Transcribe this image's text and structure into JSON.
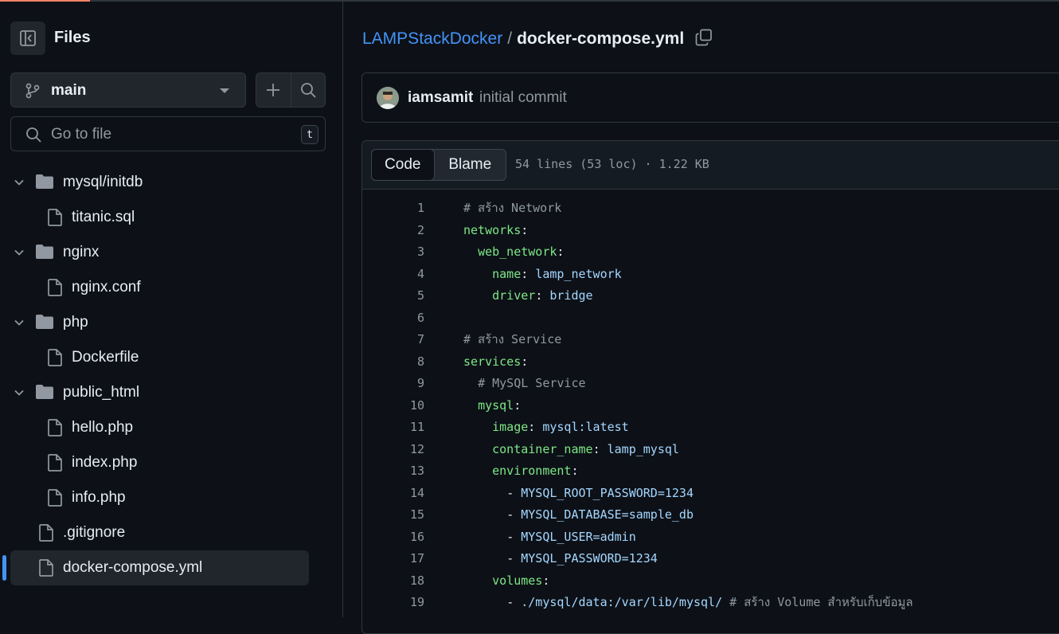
{
  "sidebar": {
    "title": "Files",
    "branch": "main",
    "search_placeholder": "Go to file",
    "search_shortcut": "t",
    "tree": [
      {
        "label": "mysql/initdb",
        "type": "folder"
      },
      {
        "label": "titanic.sql",
        "type": "file"
      },
      {
        "label": "nginx",
        "type": "folder"
      },
      {
        "label": "nginx.conf",
        "type": "file"
      },
      {
        "label": "php",
        "type": "folder"
      },
      {
        "label": "Dockerfile",
        "type": "file"
      },
      {
        "label": "public_html",
        "type": "folder"
      },
      {
        "label": "hello.php",
        "type": "file"
      },
      {
        "label": "index.php",
        "type": "file"
      },
      {
        "label": "info.php",
        "type": "file"
      },
      {
        "label": ".gitignore",
        "type": "file"
      },
      {
        "label": "docker-compose.yml",
        "type": "file",
        "selected": true
      }
    ]
  },
  "breadcrumb": {
    "repo": "LAMPStackDocker",
    "separator": "/",
    "file": "docker-compose.yml"
  },
  "commit": {
    "author": "iamsamit",
    "message": "initial commit"
  },
  "viewer": {
    "tab_code": "Code",
    "tab_blame": "Blame",
    "meta": "54 lines (53 loc) · 1.22 KB"
  },
  "code_lines": [
    {
      "n": "1",
      "indent": "",
      "segs": [
        [
          "c",
          "# สร้าง Network"
        ]
      ]
    },
    {
      "n": "2",
      "indent": "",
      "segs": [
        [
          "k",
          "networks"
        ],
        [
          "p",
          ":"
        ]
      ]
    },
    {
      "n": "3",
      "indent": "  ",
      "segs": [
        [
          "k",
          "web_network"
        ],
        [
          "p",
          ":"
        ]
      ]
    },
    {
      "n": "4",
      "indent": "    ",
      "segs": [
        [
          "k",
          "name"
        ],
        [
          "p",
          ": "
        ],
        [
          "v",
          "lamp_network"
        ]
      ]
    },
    {
      "n": "5",
      "indent": "    ",
      "segs": [
        [
          "k",
          "driver"
        ],
        [
          "p",
          ": "
        ],
        [
          "v",
          "bridge"
        ]
      ]
    },
    {
      "n": "6",
      "indent": "",
      "segs": []
    },
    {
      "n": "7",
      "indent": "",
      "segs": [
        [
          "c",
          "# สร้าง Service"
        ]
      ]
    },
    {
      "n": "8",
      "indent": "",
      "segs": [
        [
          "k",
          "services"
        ],
        [
          "p",
          ":"
        ]
      ]
    },
    {
      "n": "9",
      "indent": "  ",
      "segs": [
        [
          "c",
          "# MySQL Service"
        ]
      ]
    },
    {
      "n": "10",
      "indent": "  ",
      "segs": [
        [
          "k",
          "mysql"
        ],
        [
          "p",
          ":"
        ]
      ]
    },
    {
      "n": "11",
      "indent": "    ",
      "segs": [
        [
          "k",
          "image"
        ],
        [
          "p",
          ": "
        ],
        [
          "v",
          "mysql:latest"
        ]
      ]
    },
    {
      "n": "12",
      "indent": "    ",
      "segs": [
        [
          "k",
          "container_name"
        ],
        [
          "p",
          ": "
        ],
        [
          "v",
          "lamp_mysql"
        ]
      ]
    },
    {
      "n": "13",
      "indent": "    ",
      "segs": [
        [
          "k",
          "environment"
        ],
        [
          "p",
          ":"
        ]
      ]
    },
    {
      "n": "14",
      "indent": "      ",
      "segs": [
        [
          "p",
          "- "
        ],
        [
          "v",
          "MYSQL_ROOT_PASSWORD=1234"
        ]
      ]
    },
    {
      "n": "15",
      "indent": "      ",
      "segs": [
        [
          "p",
          "- "
        ],
        [
          "v",
          "MYSQL_DATABASE=sample_db"
        ]
      ]
    },
    {
      "n": "16",
      "indent": "      ",
      "segs": [
        [
          "p",
          "- "
        ],
        [
          "v",
          "MYSQL_USER=admin"
        ]
      ]
    },
    {
      "n": "17",
      "indent": "      ",
      "segs": [
        [
          "p",
          "- "
        ],
        [
          "v",
          "MYSQL_PASSWORD=1234"
        ]
      ]
    },
    {
      "n": "18",
      "indent": "    ",
      "segs": [
        [
          "k",
          "volumes"
        ],
        [
          "p",
          ":"
        ]
      ]
    },
    {
      "n": "19",
      "indent": "      ",
      "segs": [
        [
          "p",
          "- "
        ],
        [
          "v",
          "./mysql/data:/var/lib/mysql/"
        ],
        [
          "p",
          " "
        ],
        [
          "c",
          "# สร้าง Volume สำหรับเก็บข้อมูล"
        ]
      ]
    }
  ],
  "colors": {
    "accent": "#4493f8",
    "background": "#0d1117",
    "yaml_key": "#7ee787",
    "yaml_value": "#a5d6ff",
    "comment": "#9198a1"
  }
}
